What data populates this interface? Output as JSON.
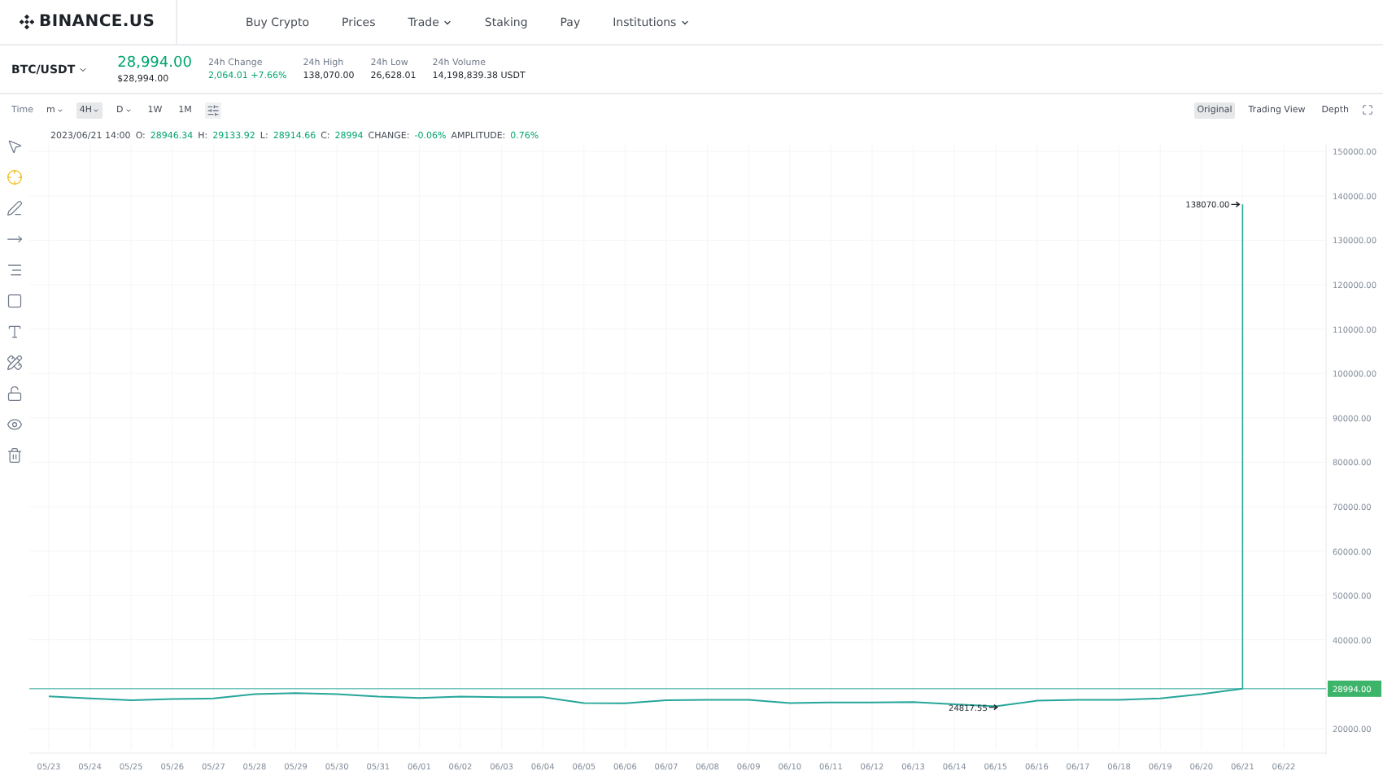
{
  "header": {
    "logo": "BINANCE.US",
    "nav": [
      {
        "label": "Buy Crypto",
        "has_menu": false
      },
      {
        "label": "Prices",
        "has_menu": false
      },
      {
        "label": "Trade",
        "has_menu": true
      },
      {
        "label": "Staking",
        "has_menu": false
      },
      {
        "label": "Pay",
        "has_menu": false
      },
      {
        "label": "Institutions",
        "has_menu": true
      }
    ]
  },
  "ticker": {
    "pair": "BTC/USDT",
    "price": "28,994.00",
    "price_usd": "$28,994.00",
    "stats": [
      {
        "label": "24h Change",
        "value": "2,064.01 +7.66%",
        "kind": "up"
      },
      {
        "label": "24h High",
        "value": "138,070.00",
        "kind": "plain"
      },
      {
        "label": "24h Low",
        "value": "26,628.01",
        "kind": "plain"
      },
      {
        "label": "24h Volume",
        "value": "14,198,839.38 USDT",
        "kind": "plain"
      }
    ]
  },
  "toolbar": {
    "time_label": "Time",
    "intervals": [
      {
        "label": "m",
        "selected": false,
        "has_menu": true
      },
      {
        "label": "4H",
        "selected": true,
        "has_menu": true
      },
      {
        "label": "D",
        "selected": false,
        "has_menu": true
      },
      {
        "label": "1W",
        "selected": false,
        "has_menu": false
      },
      {
        "label": "1M",
        "selected": false,
        "has_menu": false
      }
    ],
    "views": [
      {
        "label": "Original",
        "selected": true
      },
      {
        "label": "Trading View",
        "selected": false
      },
      {
        "label": "Depth",
        "selected": false
      }
    ]
  },
  "tools": [
    {
      "kind": "pointer",
      "selected": false
    },
    {
      "kind": "crosshair",
      "selected": true
    },
    {
      "kind": "line",
      "selected": false
    },
    {
      "kind": "arrow",
      "selected": false
    },
    {
      "kind": "fib",
      "selected": false
    },
    {
      "kind": "rect",
      "selected": false
    },
    {
      "kind": "text",
      "selected": false
    },
    {
      "kind": "measure",
      "selected": false
    },
    {
      "kind": "lock",
      "selected": false
    },
    {
      "kind": "eye",
      "selected": false
    },
    {
      "kind": "trash",
      "selected": false
    }
  ],
  "ohlc": {
    "time": "2023/06/21 14:00",
    "fields": [
      {
        "label": "O:",
        "value": "28946.34"
      },
      {
        "label": "H:",
        "value": "29133.92"
      },
      {
        "label": "L:",
        "value": "28914.66"
      },
      {
        "label": "C:",
        "value": "28994"
      },
      {
        "label": "CHANGE:",
        "value": "-0.06%"
      },
      {
        "label": "AMPLITUDE:",
        "value": "0.76%"
      }
    ]
  },
  "chart_labels": {
    "high": "138070.00",
    "low": "24817.55",
    "last": "28994.00"
  },
  "chart_data": {
    "type": "line",
    "grid": true,
    "ref_lines": [
      {
        "axis": "y",
        "value": 28994
      },
      {
        "axis": "x",
        "value": "06/21"
      }
    ],
    "categories": [
      "05/23",
      "05/24",
      "05/25",
      "05/26",
      "05/27",
      "05/28",
      "05/29",
      "05/30",
      "05/31",
      "06/01",
      "06/02",
      "06/03",
      "06/04",
      "06/05",
      "06/06",
      "06/07",
      "06/08",
      "06/09",
      "06/10",
      "06/11",
      "06/12",
      "06/13",
      "06/14",
      "06/15",
      "06/16",
      "06/17",
      "06/18",
      "06/19",
      "06/20",
      "06/21",
      "06/22"
    ],
    "series": [
      {
        "color": "#26a69a",
        "values": [
          27300,
          26800,
          26400,
          26700,
          26800,
          27800,
          28000,
          27800,
          27200,
          26900,
          27200,
          27100,
          27100,
          25800,
          25700,
          26400,
          26500,
          26500,
          25800,
          25900,
          25900,
          26000,
          25500,
          25000,
          26300,
          26500,
          26500,
          26800,
          27800,
          29000,
          null
        ]
      }
    ],
    "ylim": [
      14500,
      151500
    ],
    "yticks": [
      {
        "value": 20000,
        "label": "20000.00"
      },
      {
        "value": 40000,
        "label": "40000.00"
      },
      {
        "value": 50000,
        "label": "50000.00"
      },
      {
        "value": 60000,
        "label": "60000.00"
      },
      {
        "value": 70000,
        "label": "70000.00"
      },
      {
        "value": 80000,
        "label": "80000.00"
      },
      {
        "value": 90000,
        "label": "90000.00"
      },
      {
        "value": 100000,
        "label": "100000.00"
      },
      {
        "value": 110000,
        "label": "110000.00"
      },
      {
        "value": 120000,
        "label": "120000.00"
      },
      {
        "value": 130000,
        "label": "130000.00"
      },
      {
        "value": 140000,
        "label": "140000.00"
      },
      {
        "value": 150000,
        "label": "150000.00"
      }
    ]
  }
}
